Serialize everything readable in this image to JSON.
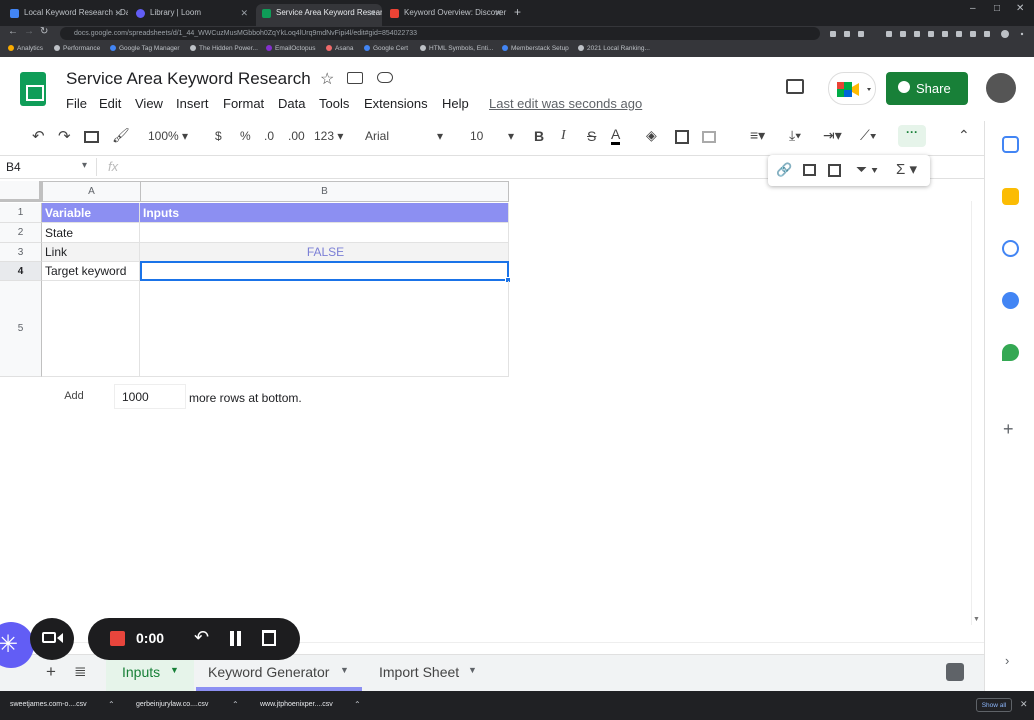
{
  "browser": {
    "tabs": [
      {
        "label": "Local Keyword Research · Dalton",
        "color": "#4285f4"
      },
      {
        "label": "Library | Loom",
        "color": "#625df5"
      },
      {
        "label": "Service Area Keyword Research",
        "color": "#0f9d58",
        "active": true
      },
      {
        "label": "Keyword Overview: Discover Ne...",
        "color": "#ea4335"
      }
    ],
    "url": "docs.google.com/spreadsheets/d/1_44_WWCuzMusMGbboh0ZqYkLoq4lUrq9mdNvFipi4l/edit#gid=854022733",
    "bookmarks": [
      "Analytics",
      "Performance",
      "Google Tag Manager",
      "The Hidden Power...",
      "EmailOctopus",
      "Asana",
      "Google Cert",
      "HTML Symbols, Enti...",
      "Memberstack Setup",
      "2021 Local Ranking..."
    ]
  },
  "doc": {
    "title": "Service Area Keyword Research",
    "menu": [
      "File",
      "Edit",
      "View",
      "Insert",
      "Format",
      "Data",
      "Tools",
      "Extensions",
      "Help"
    ],
    "last_edit": "Last edit was seconds ago",
    "share_label": "Share"
  },
  "toolbar": {
    "zoom": "100%",
    "currency": "$",
    "percent": "%",
    "dec_less": ".0",
    "dec_more": ".00",
    "format": "123",
    "font": "Arial",
    "size": "10",
    "bold": "B",
    "italic": "I",
    "strike": "S",
    "text_color": "A"
  },
  "formula_bar": {
    "namebox": "B4",
    "fx": "fx"
  },
  "grid": {
    "columns": [
      "A",
      "B"
    ],
    "rows": [
      "1",
      "2",
      "3",
      "4",
      "5"
    ],
    "cells": {
      "a1": "Variable",
      "b1": "Inputs",
      "a2": "State",
      "b2": "",
      "a3": "Link",
      "b3": "FALSE",
      "a4": "Target keyword",
      "b4": ""
    },
    "header_color": "#8c8ff2"
  },
  "add_rows": {
    "button": "Add",
    "count": "1000",
    "suffix": "more rows at bottom."
  },
  "sheets": [
    "Inputs",
    "Keyword Generator",
    "Import Sheet"
  ],
  "loom": {
    "timer": "0:00"
  },
  "downloads": [
    "sweetjames.com-o....csv",
    "gerbeinjurylaw.co....csv",
    "www.jtphoenixper....csv"
  ],
  "downloads_show_all": "Show all"
}
